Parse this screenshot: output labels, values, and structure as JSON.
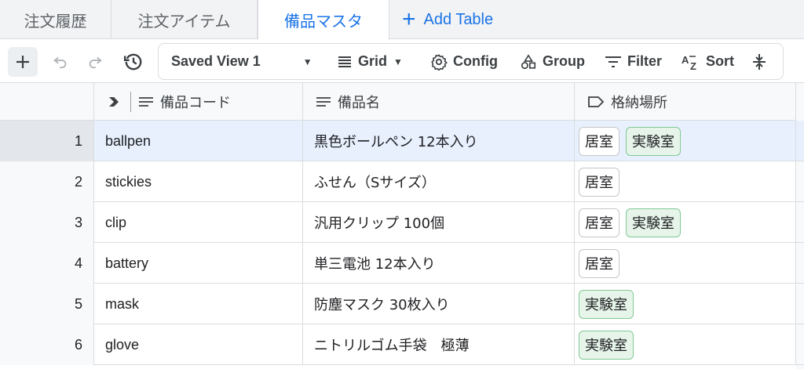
{
  "tabs": [
    "注文履歴",
    "注文アイテム",
    "備品マスタ"
  ],
  "add_table_label": "Add Table",
  "toolbar": {
    "view_label": "Saved View 1",
    "grid_label": "Grid",
    "config_label": "Config",
    "group_label": "Group",
    "filter_label": "Filter",
    "sort_label": "Sort"
  },
  "columns": [
    "備品コード",
    "備品名",
    "格納場所"
  ],
  "rows": [
    {
      "num": "1",
      "code": "ballpen",
      "name": "黒色ボールペン 12本入り",
      "tags": [
        "居室",
        "実験室"
      ]
    },
    {
      "num": "2",
      "code": "stickies",
      "name": "ふせん（Sサイズ）",
      "tags": [
        "居室"
      ]
    },
    {
      "num": "3",
      "code": "clip",
      "name": "汎用クリップ 100個",
      "tags": [
        "居室",
        "実験室"
      ]
    },
    {
      "num": "4",
      "code": "battery",
      "name": "単三電池 12本入り",
      "tags": [
        "居室"
      ]
    },
    {
      "num": "5",
      "code": "mask",
      "name": "防塵マスク 30枚入り",
      "tags": [
        "実験室"
      ]
    },
    {
      "num": "6",
      "code": "glove",
      "name": "ニトリルゴム手袋　極薄",
      "tags": [
        "実験室"
      ]
    }
  ],
  "colors": {
    "accent": "#1a73e8",
    "chip_green": "#e6f4ea",
    "selected_row": "#e8f0fe"
  }
}
